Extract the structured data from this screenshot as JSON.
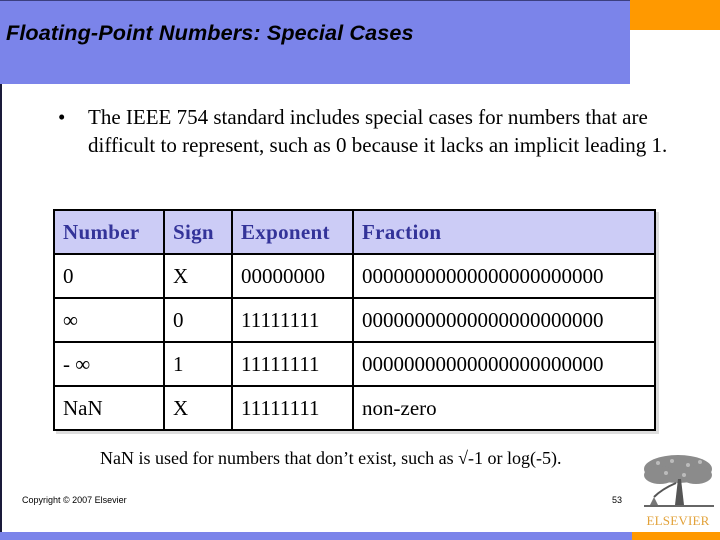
{
  "slide": {
    "title": "Floating-Point Numbers: Special Cases",
    "bullet": {
      "symbol": "•",
      "text": "The IEEE 754 standard includes special cases for numbers that are difficult to represent, such as 0 because it lacks an implicit leading 1."
    },
    "table": {
      "headers": [
        "Number",
        "Sign",
        "Exponent",
        "Fraction"
      ],
      "rows": [
        [
          "0",
          "X",
          "00000000",
          "00000000000000000000000"
        ],
        [
          "∞",
          "0",
          "11111111",
          "00000000000000000000000"
        ],
        [
          "- ∞",
          "1",
          "11111111",
          "00000000000000000000000"
        ],
        [
          "NaN",
          "X",
          "11111111",
          "non-zero"
        ]
      ]
    },
    "footnote": "NaN is used for numbers that don’t exist, such as √-1 or log(-5).",
    "copyright": "Copyright © 2007 Elsevier",
    "page_number": "53",
    "logo": {
      "icon": "elsevier-tree-logo",
      "text": "ELSEVIER"
    }
  },
  "colors": {
    "title_bar": "#7b84ea",
    "accent": "#ff9900",
    "table_header_bg": "#ccccf6",
    "table_header_text": "#333399",
    "logo_text": "#e2a23a"
  }
}
